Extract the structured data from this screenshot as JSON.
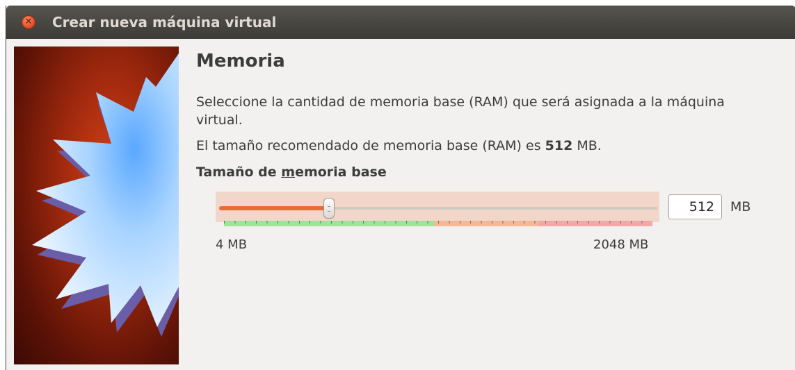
{
  "window": {
    "title": "Crear nueva máquina virtual"
  },
  "page": {
    "heading": "Memoria",
    "description": "Seleccione la cantidad de memoria base (RAM) que será asignada a la máquina virtual.",
    "recommended_prefix": "El tamaño recomendado de memoria base (RAM) es ",
    "recommended_value": "512",
    "recommended_suffix": " MB."
  },
  "memory": {
    "label": "Tamaño de memoria base",
    "label_mnemonic_pre": "Tamaño de ",
    "label_mnemonic_key": "m",
    "label_mnemonic_post": "emoria base",
    "value": "512",
    "unit": "MB",
    "min_label": "4 MB",
    "max_label": "2048 MB",
    "min": 4,
    "max": 2048,
    "slider_fraction": 0.25
  },
  "colors": {
    "titlebar": "#3c3b37",
    "accent": "#e96b3c",
    "zone_green": "#9fe29a",
    "zone_orange": "#f2b898",
    "zone_red": "#f2a8a5"
  },
  "icons": {
    "close": "close-icon",
    "art": "virtualbox-star-art"
  }
}
